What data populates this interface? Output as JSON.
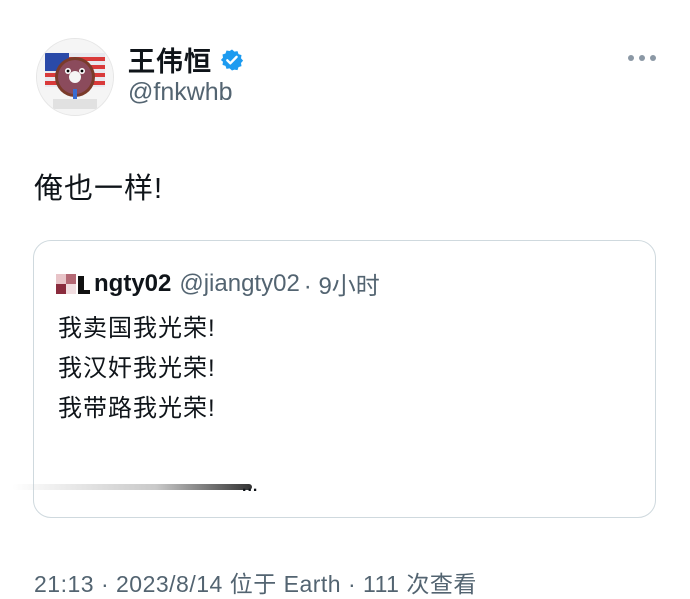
{
  "author": {
    "display_name": "王伟恒",
    "handle": "@fnkwhb",
    "avatar_icon": "donut-flag-avatar-icon",
    "verified_color": "#1d9bf0"
  },
  "tweet": {
    "text": "俺也一样!"
  },
  "quoted_tweet": {
    "display_name": "ngty02",
    "handle": "@jiangty02",
    "time": "· 9小时",
    "lines": [
      "我卖国我光荣!",
      "我汉奸我光荣!",
      "我带路我光荣!"
    ],
    "show_more": "..."
  },
  "footer": {
    "meta": "21:13 · 2023/8/14 位于 Earth · 111 次查看"
  }
}
